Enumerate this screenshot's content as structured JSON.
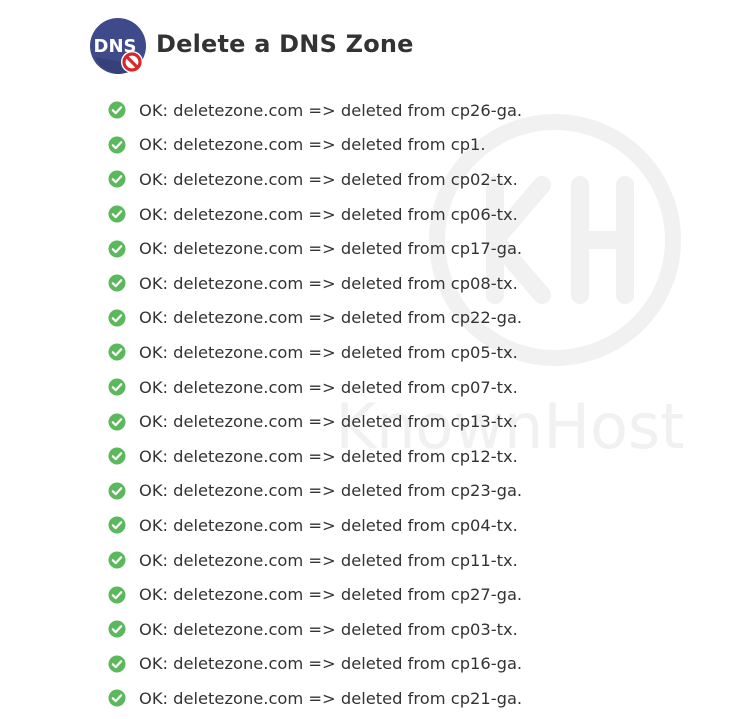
{
  "header": {
    "icon_text": "DNS",
    "icon": "dns-delete-icon",
    "title": "Delete a DNS Zone"
  },
  "watermark": {
    "text": "KnownHost"
  },
  "colors": {
    "success": "#5cb85c",
    "text": "#333333",
    "icon_bg": "#3f4a8a",
    "no_sign": "#d9262b"
  },
  "results": [
    {
      "status_icon": "check-circle-icon",
      "message": "OK: deletezone.com => deleted from cp26-ga."
    },
    {
      "status_icon": "check-circle-icon",
      "message": "OK: deletezone.com => deleted from cp1."
    },
    {
      "status_icon": "check-circle-icon",
      "message": "OK: deletezone.com => deleted from cp02-tx."
    },
    {
      "status_icon": "check-circle-icon",
      "message": "OK: deletezone.com => deleted from cp06-tx."
    },
    {
      "status_icon": "check-circle-icon",
      "message": "OK: deletezone.com => deleted from cp17-ga."
    },
    {
      "status_icon": "check-circle-icon",
      "message": "OK: deletezone.com => deleted from cp08-tx."
    },
    {
      "status_icon": "check-circle-icon",
      "message": "OK: deletezone.com => deleted from cp22-ga."
    },
    {
      "status_icon": "check-circle-icon",
      "message": "OK: deletezone.com => deleted from cp05-tx."
    },
    {
      "status_icon": "check-circle-icon",
      "message": "OK: deletezone.com => deleted from cp07-tx."
    },
    {
      "status_icon": "check-circle-icon",
      "message": "OK: deletezone.com => deleted from cp13-tx."
    },
    {
      "status_icon": "check-circle-icon",
      "message": "OK: deletezone.com => deleted from cp12-tx."
    },
    {
      "status_icon": "check-circle-icon",
      "message": "OK: deletezone.com => deleted from cp23-ga."
    },
    {
      "status_icon": "check-circle-icon",
      "message": "OK: deletezone.com => deleted from cp04-tx."
    },
    {
      "status_icon": "check-circle-icon",
      "message": "OK: deletezone.com => deleted from cp11-tx."
    },
    {
      "status_icon": "check-circle-icon",
      "message": "OK: deletezone.com => deleted from cp27-ga."
    },
    {
      "status_icon": "check-circle-icon",
      "message": "OK: deletezone.com => deleted from cp03-tx."
    },
    {
      "status_icon": "check-circle-icon",
      "message": "OK: deletezone.com => deleted from cp16-ga."
    },
    {
      "status_icon": "check-circle-icon",
      "message": "OK: deletezone.com => deleted from cp21-ga."
    }
  ]
}
